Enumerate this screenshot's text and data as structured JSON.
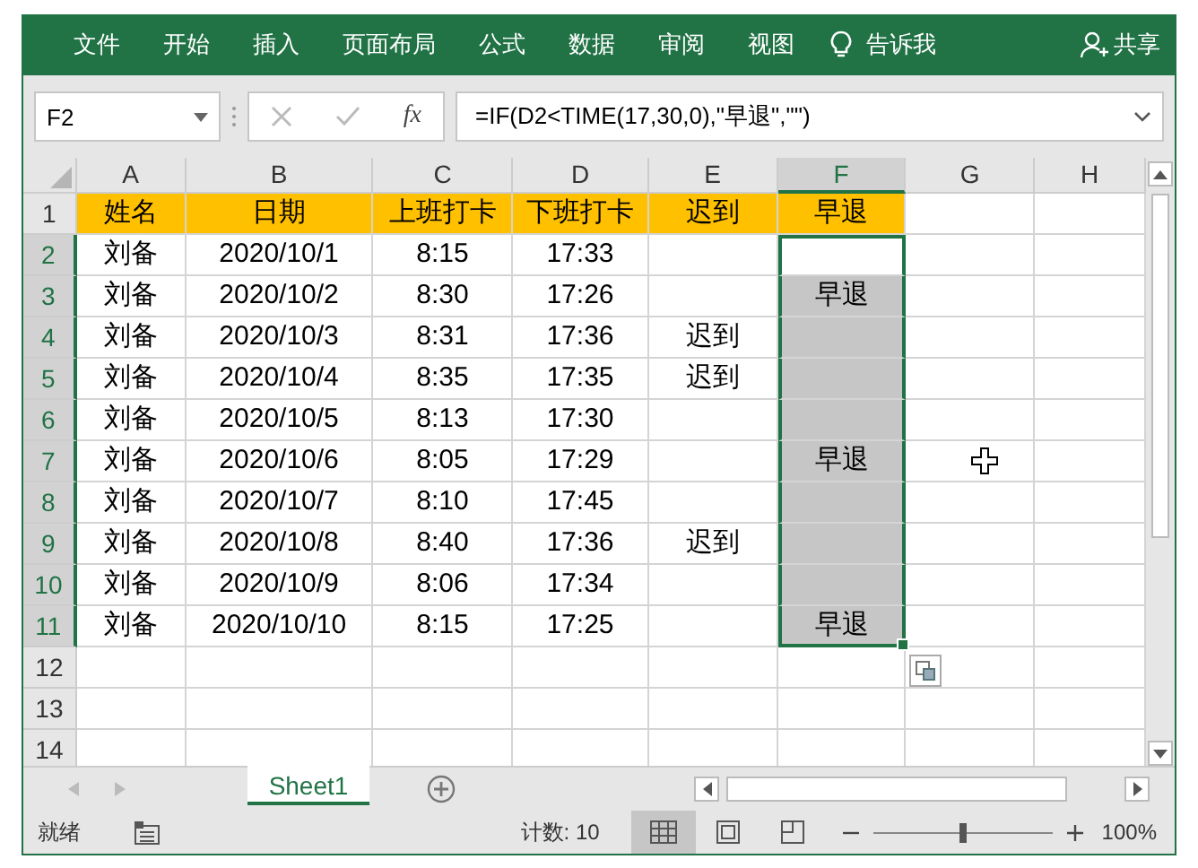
{
  "ribbon": {
    "tabs": [
      "文件",
      "开始",
      "插入",
      "页面布局",
      "公式",
      "数据",
      "审阅",
      "视图"
    ],
    "tell_me": "告诉我",
    "share": "共享"
  },
  "formula_bar": {
    "name_box": "F2",
    "fx": "fx",
    "formula": "=IF(D2<TIME(17,30,0),\"早退\",\"\")"
  },
  "columns": [
    {
      "label": "A",
      "selected": false
    },
    {
      "label": "B",
      "selected": false
    },
    {
      "label": "C",
      "selected": false
    },
    {
      "label": "D",
      "selected": false
    },
    {
      "label": "E",
      "selected": false
    },
    {
      "label": "F",
      "selected": true
    },
    {
      "label": "G",
      "selected": false
    },
    {
      "label": "H",
      "selected": false
    }
  ],
  "rows": [
    {
      "number": "1",
      "kind": "header",
      "selected": false,
      "cells": [
        "姓名",
        "日期",
        "上班打卡",
        "下班打卡",
        "迟到",
        "早退"
      ]
    },
    {
      "number": "2",
      "kind": "data",
      "selected": true,
      "cells": [
        "刘备",
        "2020/10/1",
        "8:15",
        "17:33"
      ]
    },
    {
      "number": "3",
      "kind": "data",
      "selected": true,
      "cells": [
        "刘备",
        "2020/10/2",
        "8:30",
        "17:26",
        "",
        "早退"
      ]
    },
    {
      "number": "4",
      "kind": "data",
      "selected": true,
      "cells": [
        "刘备",
        "2020/10/3",
        "8:31",
        "17:36",
        "迟到"
      ]
    },
    {
      "number": "5",
      "kind": "data",
      "selected": true,
      "cells": [
        "刘备",
        "2020/10/4",
        "8:35",
        "17:35",
        "迟到"
      ]
    },
    {
      "number": "6",
      "kind": "data",
      "selected": true,
      "cells": [
        "刘备",
        "2020/10/5",
        "8:13",
        "17:30"
      ]
    },
    {
      "number": "7",
      "kind": "data",
      "selected": true,
      "cells": [
        "刘备",
        "2020/10/6",
        "8:05",
        "17:29",
        "",
        "早退"
      ]
    },
    {
      "number": "8",
      "kind": "data",
      "selected": true,
      "cells": [
        "刘备",
        "2020/10/7",
        "8:10",
        "17:45"
      ]
    },
    {
      "number": "9",
      "kind": "data",
      "selected": true,
      "cells": [
        "刘备",
        "2020/10/8",
        "8:40",
        "17:36",
        "迟到"
      ]
    },
    {
      "number": "10",
      "kind": "data",
      "selected": true,
      "cells": [
        "刘备",
        "2020/10/9",
        "8:06",
        "17:34"
      ]
    },
    {
      "number": "11",
      "kind": "data",
      "selected": true,
      "cells": [
        "刘备",
        "2020/10/10",
        "8:15",
        "17:25",
        "",
        "早退"
      ]
    },
    {
      "number": "12",
      "kind": "data",
      "selected": false,
      "cells": []
    },
    {
      "number": "13",
      "kind": "data",
      "selected": false,
      "cells": []
    },
    {
      "number": "14",
      "kind": "data",
      "selected": false,
      "cells": []
    }
  ],
  "sheet_tabs": [
    {
      "label": "Sheet1",
      "selected": true
    }
  ],
  "status_bar": {
    "status": "就绪",
    "count": "计数: 10",
    "views": [
      {
        "kind": "normal",
        "selected": true
      },
      {
        "kind": "layout",
        "selected": false
      },
      {
        "kind": "break",
        "selected": false
      }
    ],
    "zoom": {
      "level": 0.5,
      "label": "100%"
    }
  }
}
